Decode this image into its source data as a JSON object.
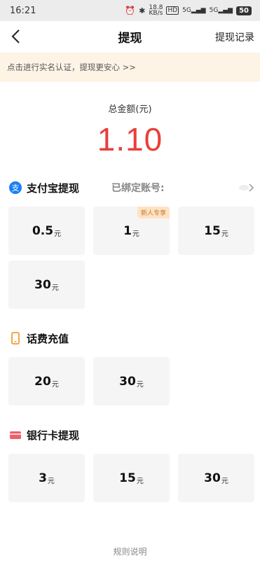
{
  "status_bar": {
    "time": "16:21",
    "net_speed": "18.8",
    "net_unit": "KB/s",
    "hd": "HD",
    "sig1": "5G",
    "sig2": "5G",
    "battery": "50"
  },
  "nav": {
    "title": "提现",
    "right_label": "提现记录"
  },
  "notice": {
    "text": "点击进行实名认证，提现更安心 >>"
  },
  "total": {
    "label": "总金额(元)",
    "amount": "1.10"
  },
  "alipay": {
    "title": "支付宝提现",
    "bound_label": "已绑定账号:",
    "options": [
      {
        "value": "0.5",
        "unit": "元"
      },
      {
        "value": "1",
        "unit": "元",
        "tag": "新人专享"
      },
      {
        "value": "15",
        "unit": "元"
      },
      {
        "value": "30",
        "unit": "元"
      }
    ]
  },
  "phone": {
    "title": "话费充值",
    "options": [
      {
        "value": "20",
        "unit": "元"
      },
      {
        "value": "30",
        "unit": "元"
      }
    ]
  },
  "bank": {
    "title": "银行卡提现",
    "options": [
      {
        "value": "3",
        "unit": "元"
      },
      {
        "value": "15",
        "unit": "元"
      },
      {
        "value": "30",
        "unit": "元"
      }
    ]
  },
  "footer": {
    "rules": "规则说明"
  },
  "colors": {
    "accent_red": "#e8403a",
    "alipay_blue": "#1a7ef6",
    "phone_orange": "#f49a33",
    "bank_red": "#f25f6a",
    "notice_bg": "#fdf4e6"
  }
}
